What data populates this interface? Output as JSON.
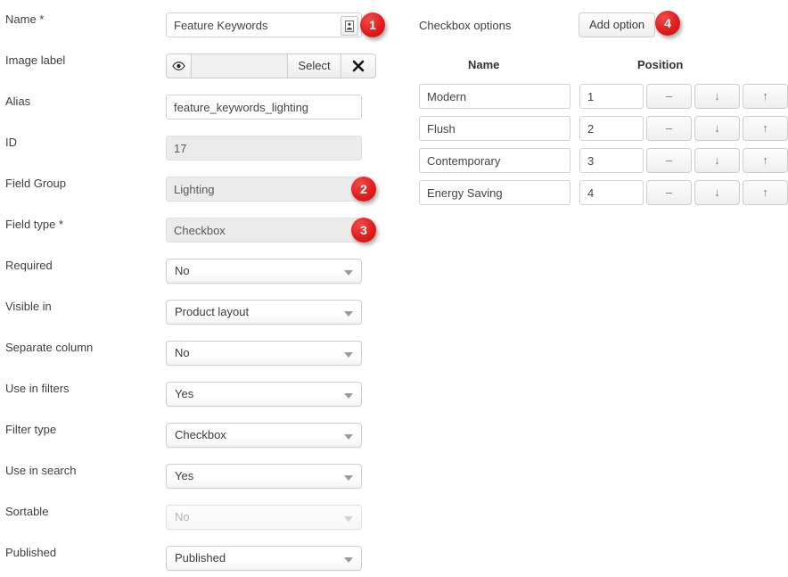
{
  "left_form": {
    "fields": [
      {
        "label": "Name *",
        "control": "text-with-button",
        "value": "Feature Keywords",
        "placeholder": "",
        "readonly": false,
        "icon": "contact-card-icon",
        "badge": "1"
      },
      {
        "label": "Image label",
        "control": "file-picker",
        "value": "",
        "placeholder": "",
        "eye_icon": "eye-icon",
        "select_label": "Select",
        "clear_icon": "close-icon"
      },
      {
        "label": "Alias",
        "control": "text",
        "value": "feature_keywords_lighting",
        "placeholder": "",
        "readonly": false
      },
      {
        "label": "ID",
        "control": "text",
        "value": "17",
        "placeholder": "",
        "readonly": true
      },
      {
        "label": "Field Group",
        "control": "text",
        "value": "Lighting",
        "placeholder": "",
        "readonly": true,
        "badge": "2"
      },
      {
        "label": "Field type *",
        "control": "text",
        "value": "Checkbox",
        "placeholder": "",
        "readonly": true,
        "badge": "3"
      },
      {
        "label": "Required",
        "control": "select",
        "value": "No",
        "disabled": false
      },
      {
        "label": "Visible in",
        "control": "select",
        "value": "Product layout",
        "disabled": false
      },
      {
        "label": "Separate column",
        "control": "select",
        "value": "No",
        "disabled": false
      },
      {
        "label": "Use in filters",
        "control": "select",
        "value": "Yes",
        "disabled": false
      },
      {
        "label": "Filter type",
        "control": "select",
        "value": "Checkbox",
        "disabled": false
      },
      {
        "label": "Use in search",
        "control": "select",
        "value": "Yes",
        "disabled": false
      },
      {
        "label": "Sortable",
        "control": "select",
        "value": "No",
        "disabled": true
      },
      {
        "label": "Published",
        "control": "select",
        "value": "Published",
        "disabled": false
      }
    ]
  },
  "right_panel": {
    "title": "Checkbox options",
    "add_button_label": "Add option",
    "add_button_badge": "4",
    "columns": {
      "name": "Name",
      "position": "Position"
    },
    "row_buttons": {
      "remove": "–",
      "move_down": "↓",
      "move_up": "↑"
    },
    "options": [
      {
        "name": "Modern",
        "position": "1"
      },
      {
        "name": "Flush",
        "position": "2"
      },
      {
        "name": "Contemporary",
        "position": "3"
      },
      {
        "name": "Energy Saving",
        "position": "4"
      }
    ]
  },
  "colors": {
    "badge_red": "#e21d1d",
    "label_text": "#3f3f3f",
    "readonly_bg": "#ebebeb",
    "border": "#d2d2d2"
  }
}
